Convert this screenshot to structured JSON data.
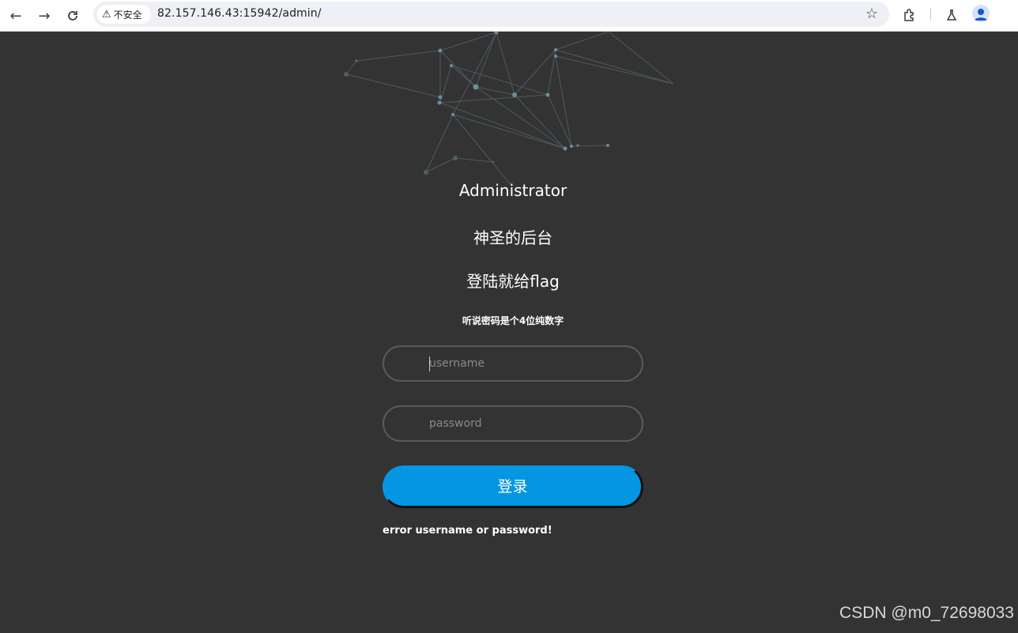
{
  "browser": {
    "security_label": "不安全",
    "url": "82.157.146.43:15942/admin/"
  },
  "page": {
    "heading": "Administrator",
    "subtitle": "神圣的后台",
    "tagline": "登陆就给flag",
    "hint": "听说密码是个4位纯数字",
    "username_placeholder": "username",
    "password_placeholder": "password",
    "login_button": "登录",
    "error_message": "error username or password!"
  },
  "watermark": "CSDN @m0_72698033",
  "colors": {
    "background": "#333333",
    "button": "#0496e3",
    "network_lines": "#5f7a86"
  }
}
